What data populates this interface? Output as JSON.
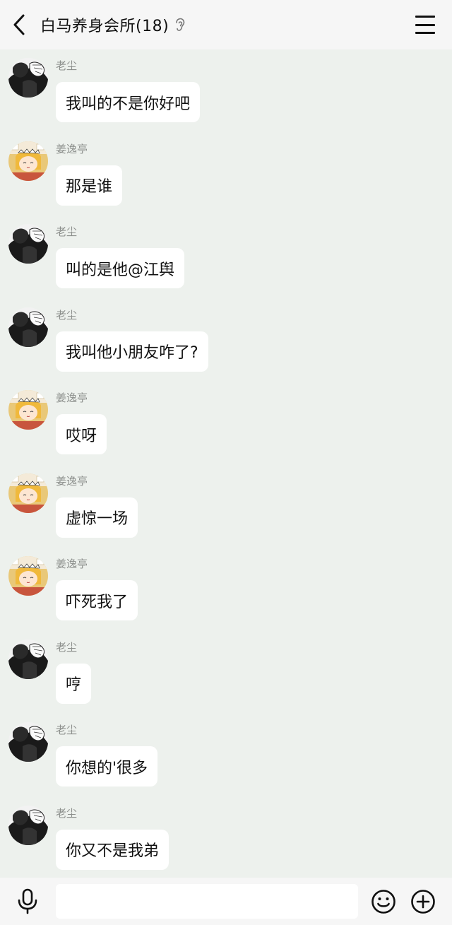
{
  "header": {
    "title": "白马养身会所(18)",
    "back_icon": "chevron-left-icon",
    "ear_icon": "ear-icon",
    "menu_icon": "hamburger-menu-icon"
  },
  "messages": [
    {
      "sender": "老尘",
      "text": "我叫的不是你好吧",
      "avatar": "avatar-laochen"
    },
    {
      "sender": "姜逸亭",
      "text": "那是谁",
      "avatar": "avatar-jiangyiting"
    },
    {
      "sender": "老尘",
      "text": "叫的是他@江舆",
      "avatar": "avatar-laochen"
    },
    {
      "sender": "老尘",
      "text": "我叫他小朋友咋了?",
      "avatar": "avatar-laochen"
    },
    {
      "sender": "姜逸亭",
      "text": "哎呀",
      "avatar": "avatar-jiangyiting"
    },
    {
      "sender": "姜逸亭",
      "text": "虚惊一场",
      "avatar": "avatar-jiangyiting"
    },
    {
      "sender": "姜逸亭",
      "text": "吓死我了",
      "avatar": "avatar-jiangyiting"
    },
    {
      "sender": "老尘",
      "text": "哼",
      "avatar": "avatar-laochen"
    },
    {
      "sender": "老尘",
      "text": "你想的'很多",
      "avatar": "avatar-laochen"
    },
    {
      "sender": "老尘",
      "text": "你又不是我弟",
      "avatar": "avatar-laochen"
    }
  ],
  "input_bar": {
    "mic_icon": "microphone-icon",
    "input_value": "",
    "emoji_icon": "smiley-icon",
    "plus_icon": "plus-circle-icon"
  },
  "colors": {
    "background": "#edf1ed",
    "bubble": "#ffffff",
    "header": "#f6f6f6"
  }
}
